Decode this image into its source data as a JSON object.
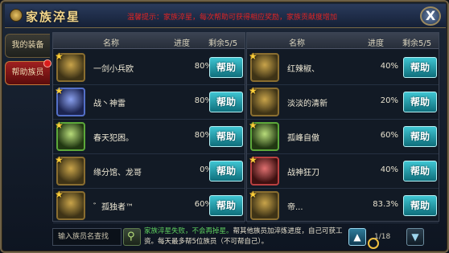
{
  "window": {
    "title": "家族淬星",
    "notice": "温馨提示：家族淬星，每次帮助可获得相应奖励，家族贡献度增加",
    "close_label": "X"
  },
  "sidebar": {
    "tabs": [
      {
        "label": "我的装备"
      },
      {
        "label": "帮助族员"
      }
    ]
  },
  "columns": {
    "name": "名称",
    "progress": "进度",
    "remaining": "剩余5/5"
  },
  "left_rows": [
    {
      "name": "一剑小兵欧",
      "progress": "80%",
      "button": "帮助",
      "frame": "gold"
    },
    {
      "name": "战丶神雷",
      "progress": "80%",
      "button": "帮助",
      "frame": "blue"
    },
    {
      "name": "春天犯困。",
      "progress": "80%",
      "button": "帮助",
      "frame": "green"
    },
    {
      "name": "缘分馆、龙哥",
      "progress": "0%",
      "button": "帮助",
      "frame": "gold"
    },
    {
      "name": "゛孤独者™",
      "progress": "60%",
      "button": "帮助",
      "frame": "gold"
    }
  ],
  "right_rows": [
    {
      "name": "红辣椒、",
      "progress": "40%",
      "button": "帮助",
      "frame": "gold"
    },
    {
      "name": "淡淡的清新",
      "progress": "20%",
      "button": "帮助",
      "frame": "gold"
    },
    {
      "name": "孤峰自傲",
      "progress": "60%",
      "button": "帮助",
      "frame": "green"
    },
    {
      "name": "战神狂刀",
      "progress": "40%",
      "button": "帮助",
      "frame": "red"
    },
    {
      "name": "帝...",
      "progress": "83.3%",
      "button": "帮助",
      "frame": "gold"
    }
  ],
  "bottom": {
    "search_placeholder": "输入族员名查找",
    "tip_highlight": "家族淬星失败，不会再掉星。",
    "tip_rest": "帮其他族员加淬炼进度，自己可获工资。每天最多帮5位族员（不可帮自己）。",
    "page": "1/18",
    "up_label": "▲",
    "down_label": "▼"
  },
  "colors": {
    "accent_title": "#f2d58a",
    "help_button": "#3fc5d2",
    "notice_red": "#e02424",
    "tip_green": "#5fd15f"
  },
  "icons": {
    "search": "magnifier-icon",
    "close": "close-icon",
    "star": "star-icon"
  }
}
